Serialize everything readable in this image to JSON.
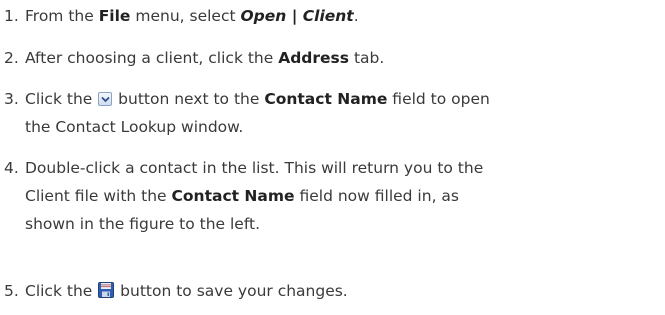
{
  "steps": [
    {
      "number": "1.",
      "parts": [
        "From the ",
        "File",
        " menu, select ",
        "Open | Client",
        "."
      ]
    },
    {
      "number": "2.",
      "parts": [
        "After choosing a client, click the ",
        "Address",
        " tab."
      ]
    },
    {
      "number": "3.",
      "parts": [
        "Click the ",
        " button next to the ",
        "Contact Name",
        " field to open",
        "the Contact Lookup window."
      ]
    },
    {
      "number": "4.",
      "parts": [
        "Double-click a contact in the list. This will return you to the",
        "Client file with the ",
        "Contact Name",
        " field now filled in, as",
        "shown in the figure to the left."
      ]
    },
    {
      "number": "5.",
      "parts": [
        "Click the ",
        " button to save your changes."
      ]
    }
  ],
  "icons": {
    "dropdown": "chevron-down-icon",
    "save": "save-icon"
  }
}
